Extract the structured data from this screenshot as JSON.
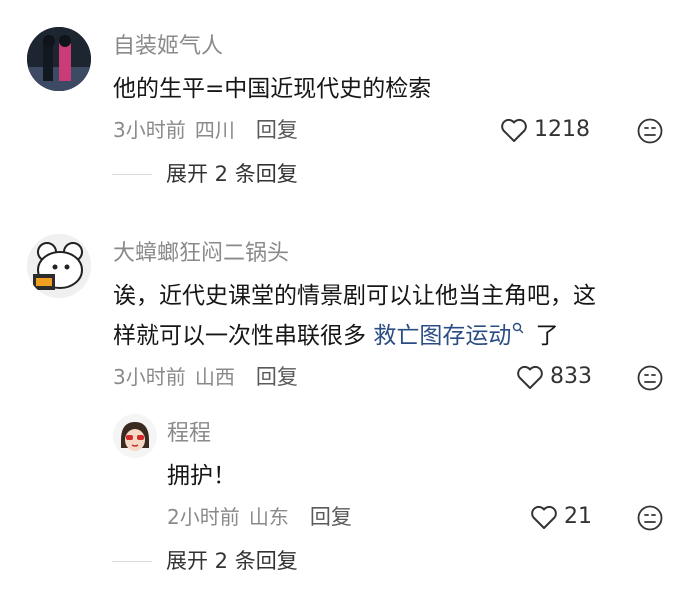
{
  "comments": [
    {
      "username": "自装姬气人",
      "text": "他的生平=中国近现代史的检索",
      "time": "3小时前",
      "location": "四川",
      "reply_label": "回复",
      "likes": "1218",
      "expand_label": "展开 2 条回复"
    },
    {
      "username": "大蟑螂狂闷二锅头",
      "text_line1": "诶，近代史课堂的情景剧可以让他当主角吧，这",
      "text_line2_prefix": "样就可以一次性串联很多",
      "text_link": "救亡图存运动",
      "text_suffix": "了",
      "time": "3小时前",
      "location": "山西",
      "reply_label": "回复",
      "likes": "833",
      "reply": {
        "username": "程程",
        "text": "拥护！",
        "time": "2小时前",
        "location": "山东",
        "reply_label": "回复",
        "likes": "21"
      },
      "expand_label": "展开 2 条回复"
    }
  ],
  "icons": {
    "like": "heart-icon",
    "dislike": "face-icon",
    "search": "search-icon"
  },
  "colors": {
    "link": "#2b4d83",
    "meta": "#8a8a8a",
    "text": "#161616"
  }
}
